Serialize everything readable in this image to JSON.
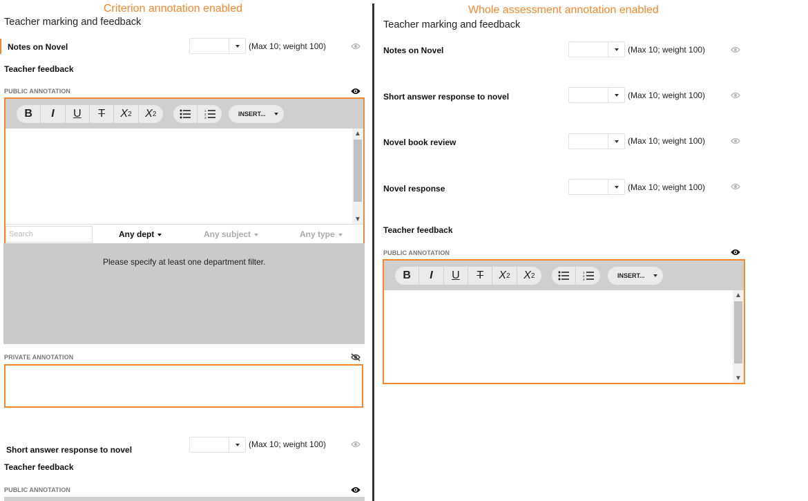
{
  "captions": {
    "left": "Criterion annotation enabled",
    "right": "Whole assessment annotation enabled"
  },
  "left": {
    "title": "Teacher marking and feedback",
    "criterion_1": {
      "label": "Notes on Novel",
      "max_text": "(Max 10; weight 100)"
    },
    "teacher_feedback": "Teacher feedback",
    "public_annotation": "PUBLIC ANNOTATION",
    "insert_label": "INSERT...",
    "search_placeholder": "Search",
    "filters": {
      "dept": "Any dept",
      "subject": "Any subject",
      "type": "Any type"
    },
    "panel_message": "Please specify at least one department filter.",
    "private_annotation": "PRIVATE ANNOTATION",
    "criterion_2": {
      "label": "Short answer response to novel",
      "max_text": "(Max 10; weight 100)"
    },
    "teacher_feedback_2": "Teacher feedback",
    "public_annotation_2": "PUBLIC ANNOTATION"
  },
  "right": {
    "title": "Teacher marking and feedback",
    "criteria": [
      {
        "label": "Notes on Novel",
        "max_text": "(Max 10; weight 100)"
      },
      {
        "label": "Short answer response to novel",
        "max_text": "(Max 10; weight 100)"
      },
      {
        "label": "Novel book review",
        "max_text": "(Max 10; weight 100)"
      },
      {
        "label": "Novel response",
        "max_text": "(Max 10; weight 100)"
      }
    ],
    "teacher_feedback": "Teacher feedback",
    "public_annotation": "PUBLIC ANNOTATION",
    "insert_label": "INSERT..."
  },
  "colors": {
    "accent": "#f5872d",
    "toolbar": "#cfcfcf",
    "panel": "#cacaca"
  }
}
